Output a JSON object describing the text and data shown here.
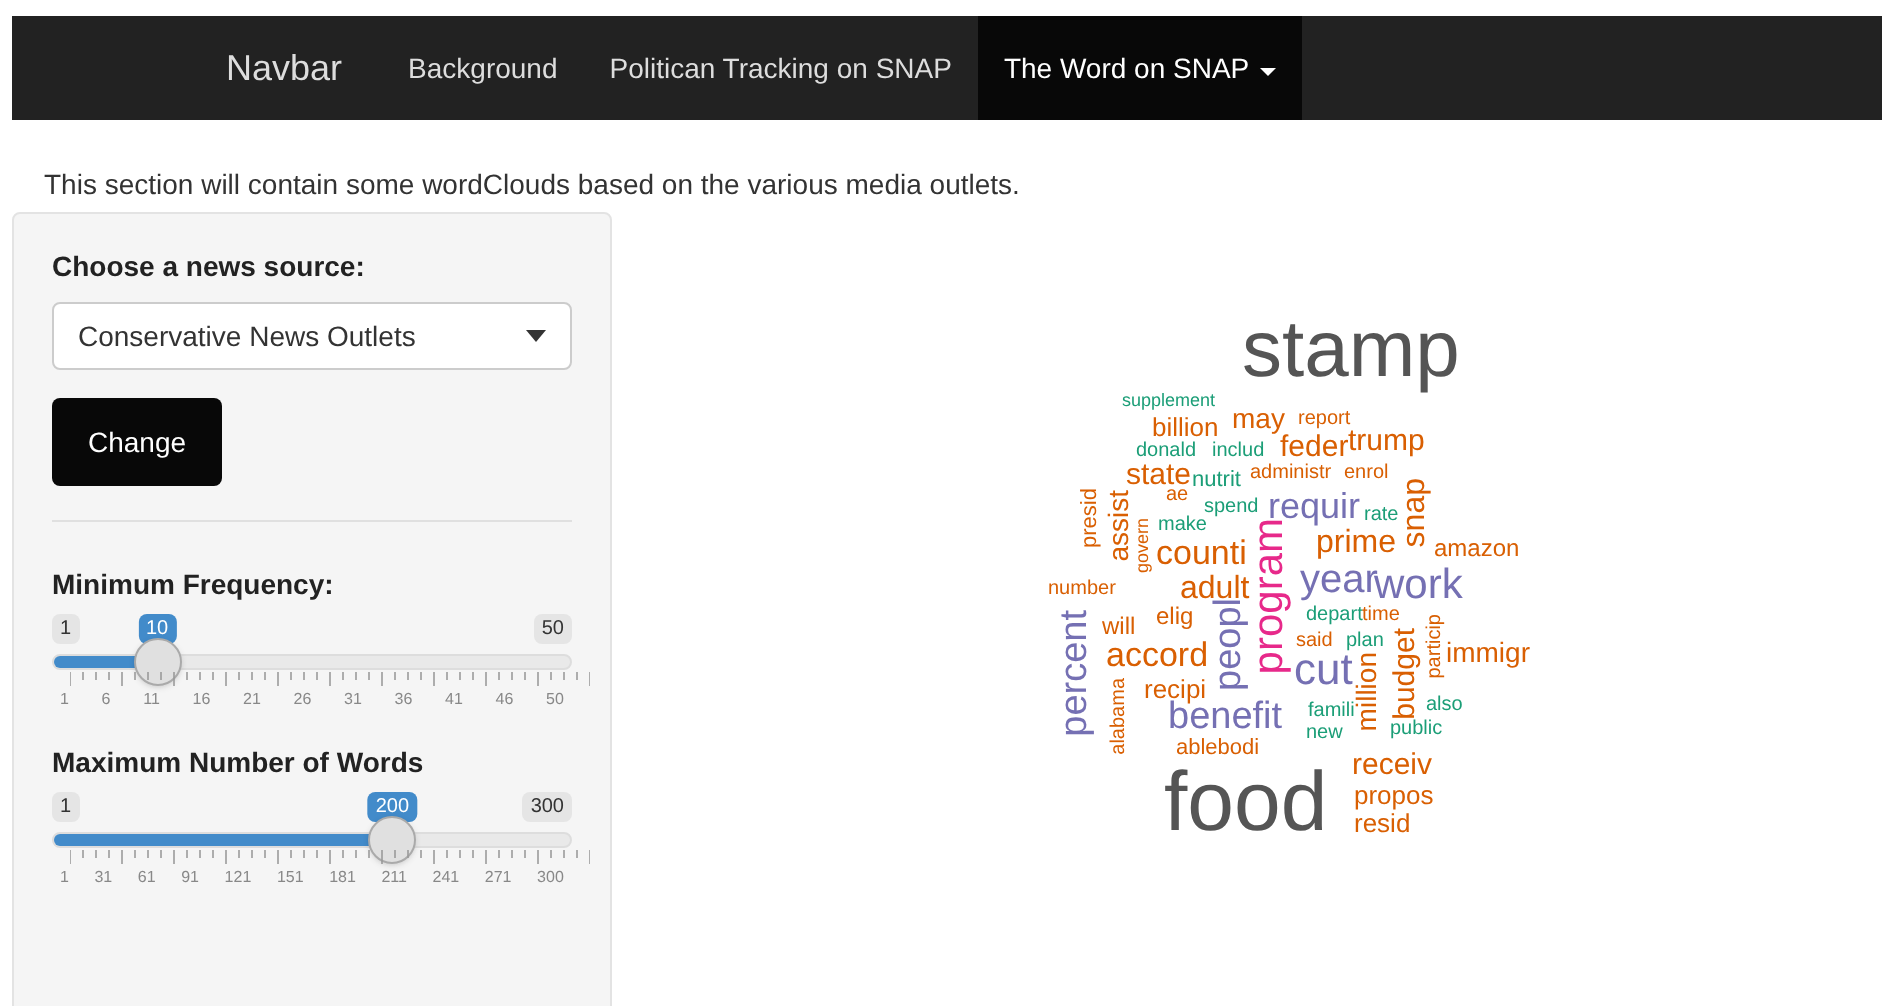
{
  "navbar": {
    "brand": "Navbar",
    "items": [
      {
        "label": "Background",
        "selected": false,
        "dropdown": false
      },
      {
        "label": "Politican Tracking on SNAP",
        "selected": false,
        "dropdown": false
      },
      {
        "label": "The Word on SNAP",
        "selected": true,
        "dropdown": true
      }
    ]
  },
  "intro": "This section will contain some wordClouds based on the various media outlets.",
  "sidebar": {
    "source_label": "Choose a news source:",
    "source_value": "Conservative News Outlets",
    "button": "Change",
    "sliders": [
      {
        "label": "Minimum Frequency:",
        "min": "1",
        "max": "50",
        "value": "10",
        "level": 0.18,
        "ticks": [
          "1",
          "6",
          "11",
          "16",
          "21",
          "26",
          "31",
          "36",
          "41",
          "46",
          "50"
        ]
      },
      {
        "label": "Maximum Number of Words",
        "min": "1",
        "max": "300",
        "value": "200",
        "level": 0.666,
        "ticks": [
          "1",
          "31",
          "61",
          "91",
          "121",
          "151",
          "181",
          "211",
          "241",
          "271",
          "300"
        ]
      }
    ]
  },
  "wordcloud": [
    {
      "text": "stamp",
      "color": "#555555"
    },
    {
      "text": "supplement",
      "color": "#1b9e77"
    },
    {
      "text": "billion",
      "color": "#d95f02"
    },
    {
      "text": "may",
      "color": "#d95f02"
    },
    {
      "text": "report",
      "color": "#d95f02"
    },
    {
      "text": "donald",
      "color": "#1b9e77"
    },
    {
      "text": "includ",
      "color": "#1b9e77"
    },
    {
      "text": "feder",
      "color": "#d95f02"
    },
    {
      "text": "trump",
      "color": "#d95f02"
    },
    {
      "text": "state",
      "color": "#d95f02"
    },
    {
      "text": "nutrit",
      "color": "#1b9e77"
    },
    {
      "text": "administr",
      "color": "#d95f02"
    },
    {
      "text": "enrol",
      "color": "#d95f02"
    },
    {
      "text": "presid",
      "color": "#d95f02"
    },
    {
      "text": "assist",
      "color": "#d95f02"
    },
    {
      "text": "ae",
      "color": "#d95f02"
    },
    {
      "text": "spend",
      "color": "#1b9e77"
    },
    {
      "text": "requir",
      "color": "#7570b3"
    },
    {
      "text": "rate",
      "color": "#1b9e77"
    },
    {
      "text": "snap",
      "color": "#d95f02"
    },
    {
      "text": "govern",
      "color": "#d95f02"
    },
    {
      "text": "make",
      "color": "#1b9e77"
    },
    {
      "text": "counti",
      "color": "#d95f02"
    },
    {
      "text": "program",
      "color": "#e7298a"
    },
    {
      "text": "prime",
      "color": "#d95f02"
    },
    {
      "text": "amazon",
      "color": "#d95f02"
    },
    {
      "text": "number",
      "color": "#d95f02"
    },
    {
      "text": "adult",
      "color": "#d95f02"
    },
    {
      "text": "year",
      "color": "#7570b3"
    },
    {
      "text": "work",
      "color": "#7570b3"
    },
    {
      "text": "percent",
      "color": "#7570b3"
    },
    {
      "text": "will",
      "color": "#d95f02"
    },
    {
      "text": "elig",
      "color": "#d95f02"
    },
    {
      "text": "peopl",
      "color": "#7570b3"
    },
    {
      "text": "depart",
      "color": "#1b9e77"
    },
    {
      "text": "time",
      "color": "#d95f02"
    },
    {
      "text": "budget",
      "color": "#d95f02"
    },
    {
      "text": "particip",
      "color": "#d95f02"
    },
    {
      "text": "accord",
      "color": "#d95f02"
    },
    {
      "text": "said",
      "color": "#d95f02"
    },
    {
      "text": "plan",
      "color": "#1b9e77"
    },
    {
      "text": "immigr",
      "color": "#d95f02"
    },
    {
      "text": "cut",
      "color": "#7570b3"
    },
    {
      "text": "million",
      "color": "#d95f02"
    },
    {
      "text": "alabama",
      "color": "#d95f02"
    },
    {
      "text": "recipi",
      "color": "#d95f02"
    },
    {
      "text": "benefit",
      "color": "#7570b3"
    },
    {
      "text": "famili",
      "color": "#1b9e77"
    },
    {
      "text": "also",
      "color": "#1b9e77"
    },
    {
      "text": "new",
      "color": "#1b9e77"
    },
    {
      "text": "public",
      "color": "#1b9e77"
    },
    {
      "text": "ablebodi",
      "color": "#d95f02"
    },
    {
      "text": "food",
      "color": "#555555"
    },
    {
      "text": "receiv",
      "color": "#d95f02"
    },
    {
      "text": "propos",
      "color": "#d95f02"
    },
    {
      "text": "resid",
      "color": "#d95f02"
    }
  ]
}
